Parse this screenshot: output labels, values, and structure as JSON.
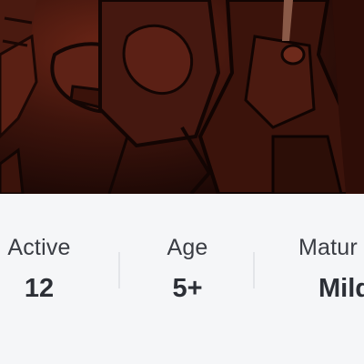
{
  "hero": {
    "image": "game-thumbnail"
  },
  "stats": [
    {
      "label": "Active",
      "value": "12"
    },
    {
      "label": "Age",
      "value": "5+"
    },
    {
      "label": "Matur",
      "value": "Mild"
    }
  ],
  "colors": {
    "background": "#f5f6f8",
    "label": "#3a3d44",
    "value": "#2c2f36",
    "divider": "#e3e5e9"
  }
}
